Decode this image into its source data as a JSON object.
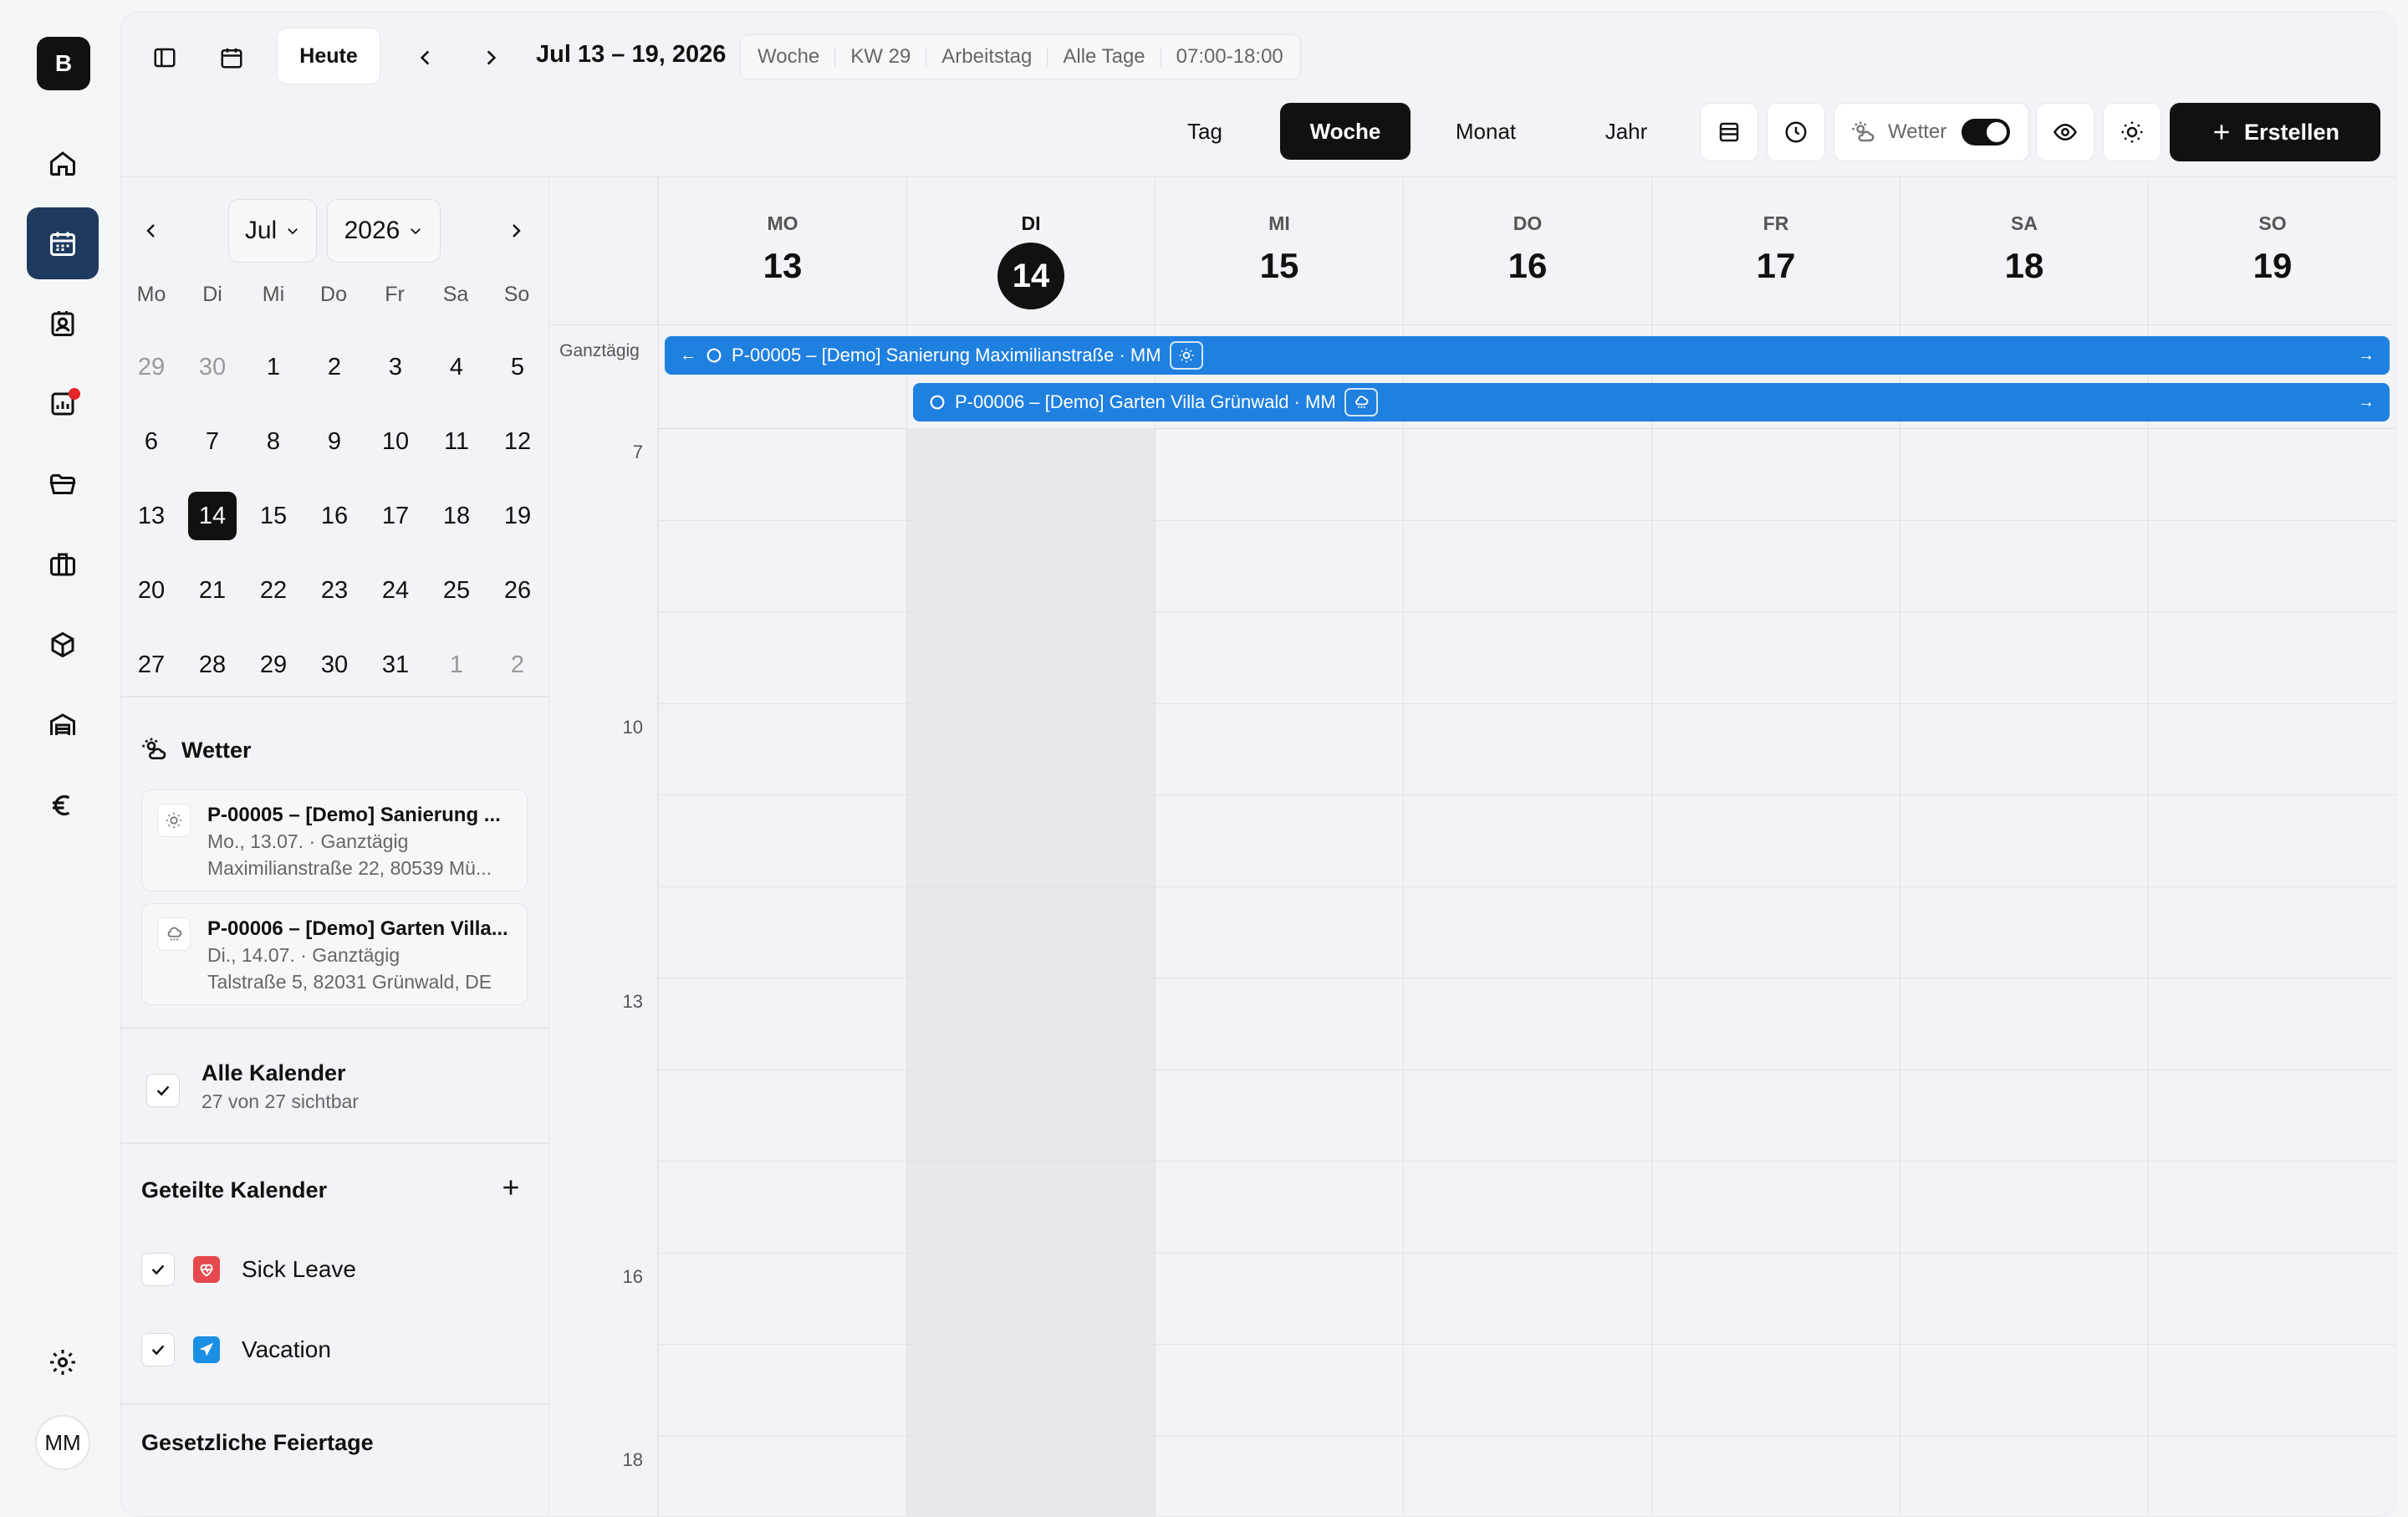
{
  "rail": {
    "logo": "B",
    "avatar": "MM",
    "items": [
      "home-icon",
      "calendar-icon",
      "contacts-icon",
      "reports-icon",
      "folder-icon",
      "briefcase-icon",
      "box-icon",
      "warehouse-icon",
      "euro-icon"
    ],
    "settings": "gear-icon"
  },
  "toolbar": {
    "today": "Heute",
    "range": "Jul 13 – 19, 2026",
    "meta": [
      "Woche",
      "KW 29",
      "Arbeitstag",
      "Alle Tage",
      "07:00-18:00"
    ],
    "views": [
      "Tag",
      "Woche",
      "Monat",
      "Jahr"
    ],
    "active_view": "Woche",
    "weather_label": "Wetter",
    "create_label": "Erstellen"
  },
  "mini": {
    "month": "Jul",
    "year": "2026",
    "dow": [
      "Mo",
      "Di",
      "Mi",
      "Do",
      "Fr",
      "Sa",
      "So"
    ],
    "weeks": [
      [
        "29",
        "30",
        "1",
        "2",
        "3",
        "4",
        "5"
      ],
      [
        "6",
        "7",
        "8",
        "9",
        "10",
        "11",
        "12"
      ],
      [
        "13",
        "14",
        "15",
        "16",
        "17",
        "18",
        "19"
      ],
      [
        "20",
        "21",
        "22",
        "23",
        "24",
        "25",
        "26"
      ],
      [
        "27",
        "28",
        "29",
        "30",
        "31",
        "1",
        "2"
      ]
    ]
  },
  "weather": {
    "title": "Wetter",
    "cards": [
      {
        "icon": "sun-icon",
        "title": "P-00005 – [Demo] Sanierung ...",
        "line1": "Mo., 13.07. · Ganztägig",
        "line2": "Maximilianstraße 22, 80539 Mü..."
      },
      {
        "icon": "cloud-rain-icon",
        "title": "P-00006 – [Demo] Garten Villa...",
        "line1": "Di., 14.07. · Ganztägig",
        "line2": "Talstraße 5, 82031 Grünwald, DE"
      }
    ]
  },
  "calendars": {
    "all_title": "Alle Kalender",
    "all_sub": "27 von 27 sichtbar",
    "shared_title": "Geteilte Kalender",
    "shared": [
      {
        "name": "Sick Leave",
        "color": "#e5484d"
      },
      {
        "name": "Vacation",
        "color": "#1a8fe3"
      }
    ],
    "holidays_title": "Gesetzliche Feiertage"
  },
  "week": {
    "days": [
      {
        "dow": "MO",
        "num": "13"
      },
      {
        "dow": "DI",
        "num": "14"
      },
      {
        "dow": "MI",
        "num": "15"
      },
      {
        "dow": "DO",
        "num": "16"
      },
      {
        "dow": "FR",
        "num": "17"
      },
      {
        "dow": "SA",
        "num": "18"
      },
      {
        "dow": "SO",
        "num": "19"
      }
    ],
    "today_index": 1,
    "allday_label": "Ganztägig",
    "hours": [
      "7",
      "10",
      "13",
      "16",
      "18"
    ],
    "events": [
      {
        "text": "P-00005 – [Demo] Sanierung Maximilianstraße · MM",
        "icon": "sun-icon"
      },
      {
        "text": "P-00006 – [Demo] Garten Villa Grünwald · MM",
        "icon": "cloud-rain-icon"
      }
    ]
  }
}
